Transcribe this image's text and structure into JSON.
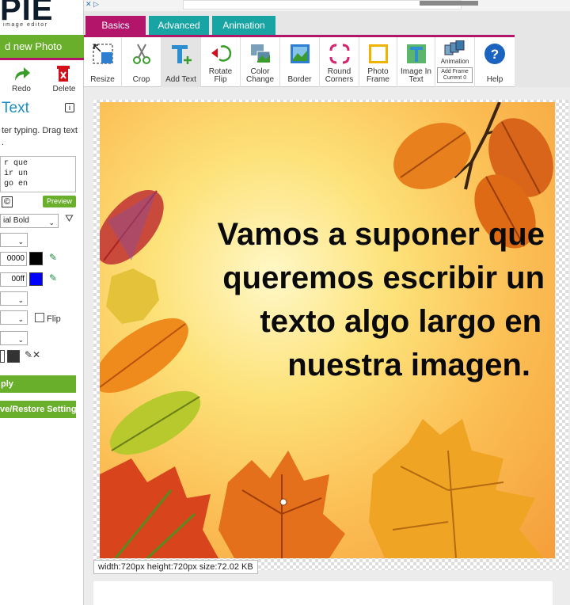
{
  "app": {
    "logo": "PIE",
    "logo_sub": "image editor"
  },
  "sidebar": {
    "new_photo": "d new Photo",
    "redo_label": "Redo",
    "delete_label": "Delete",
    "title": "Text",
    "hint": "ter typing. Drag text\n.",
    "textarea": "r que\nir un\ngo en",
    "copyright_symbol": "©",
    "preview_label": "Preview",
    "font_select": "ial Bold",
    "color1_value": "0000",
    "color2_value": "00ff",
    "flip_label": "Flip",
    "apply_label": "ply",
    "save_restore_label": "ve/Restore Setting"
  },
  "tabs": [
    {
      "label": "Basics"
    },
    {
      "label": "Advanced"
    },
    {
      "label": "Animation"
    }
  ],
  "toolbar": {
    "resize": "Resize",
    "crop": "Crop",
    "add_text": "Add Text",
    "rotate_flip_1": "Rotate",
    "rotate_flip_2": "Flip",
    "color_change_1": "Color",
    "color_change_2": "Change",
    "border": "Border",
    "round_corners_1": "Round",
    "round_corners_2": "Corners",
    "photo_frame_1": "Photo",
    "photo_frame_2": "Frame",
    "image_in_text_1": "Image In",
    "image_in_text_2": "Text",
    "animation_label": "Animation",
    "add_frame": "Add Frame",
    "current_frame": "Current 0",
    "help": "Help"
  },
  "canvas": {
    "overlay_lines": [
      "Vamos a suponer que",
      "queremos escribir un",
      "texto algo largo en",
      "nuestra imagen."
    ],
    "dimensions": "width:720px  height:720px  size:72.02 KB"
  },
  "colors": {
    "accent_magenta": "#b2156a",
    "accent_teal": "#18a4a2",
    "accent_green": "#6aaf2c",
    "color1": "#000000",
    "color2": "#0000ff"
  }
}
